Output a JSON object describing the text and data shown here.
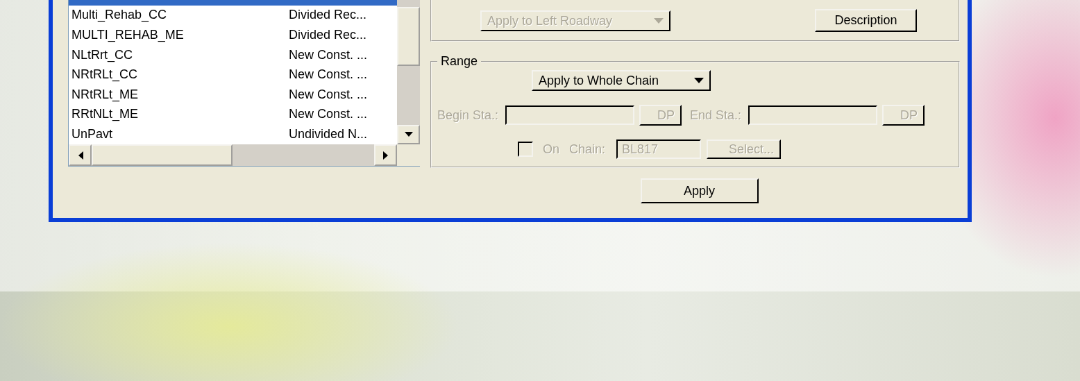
{
  "list": {
    "rows": [
      {
        "selected": true
      },
      {
        "name": "Multi_Rehab_CC",
        "description": "Divided Rec...",
        "selected": false
      },
      {
        "name": "MULTI_REHAB_ME",
        "description": "Divided Rec...",
        "selected": false
      },
      {
        "name": "NLtRrt_CC",
        "description": "New Const. ...",
        "selected": false
      },
      {
        "name": "NRtRLt_CC",
        "description": "New Const. ...",
        "selected": false
      },
      {
        "name": "NRtRLt_ME",
        "description": "New Const. ...",
        "selected": false
      },
      {
        "name": "RRtNLt_ME",
        "description": "New Const. ...",
        "selected": false
      },
      {
        "name": "UnPavt",
        "description": "Undivided N...",
        "selected": false
      }
    ]
  },
  "roadway_dropdown": {
    "value": "Apply to Left Roadway",
    "disabled": true
  },
  "description_button": "Description",
  "range": {
    "title": "Range",
    "scope_dropdown": {
      "value": "Apply to Whole Chain",
      "disabled": false
    },
    "begin_station": {
      "label": "Begin Sta.:",
      "button": "DP",
      "disabled": true
    },
    "end_station": {
      "label": "End Sta.:",
      "button": "DP",
      "disabled": true
    },
    "on_chain": {
      "checked": false,
      "label": "On",
      "chain_label": "Chain:",
      "chain": "BL817",
      "select_button": "Select...",
      "disabled": true
    }
  },
  "apply_button": "Apply"
}
